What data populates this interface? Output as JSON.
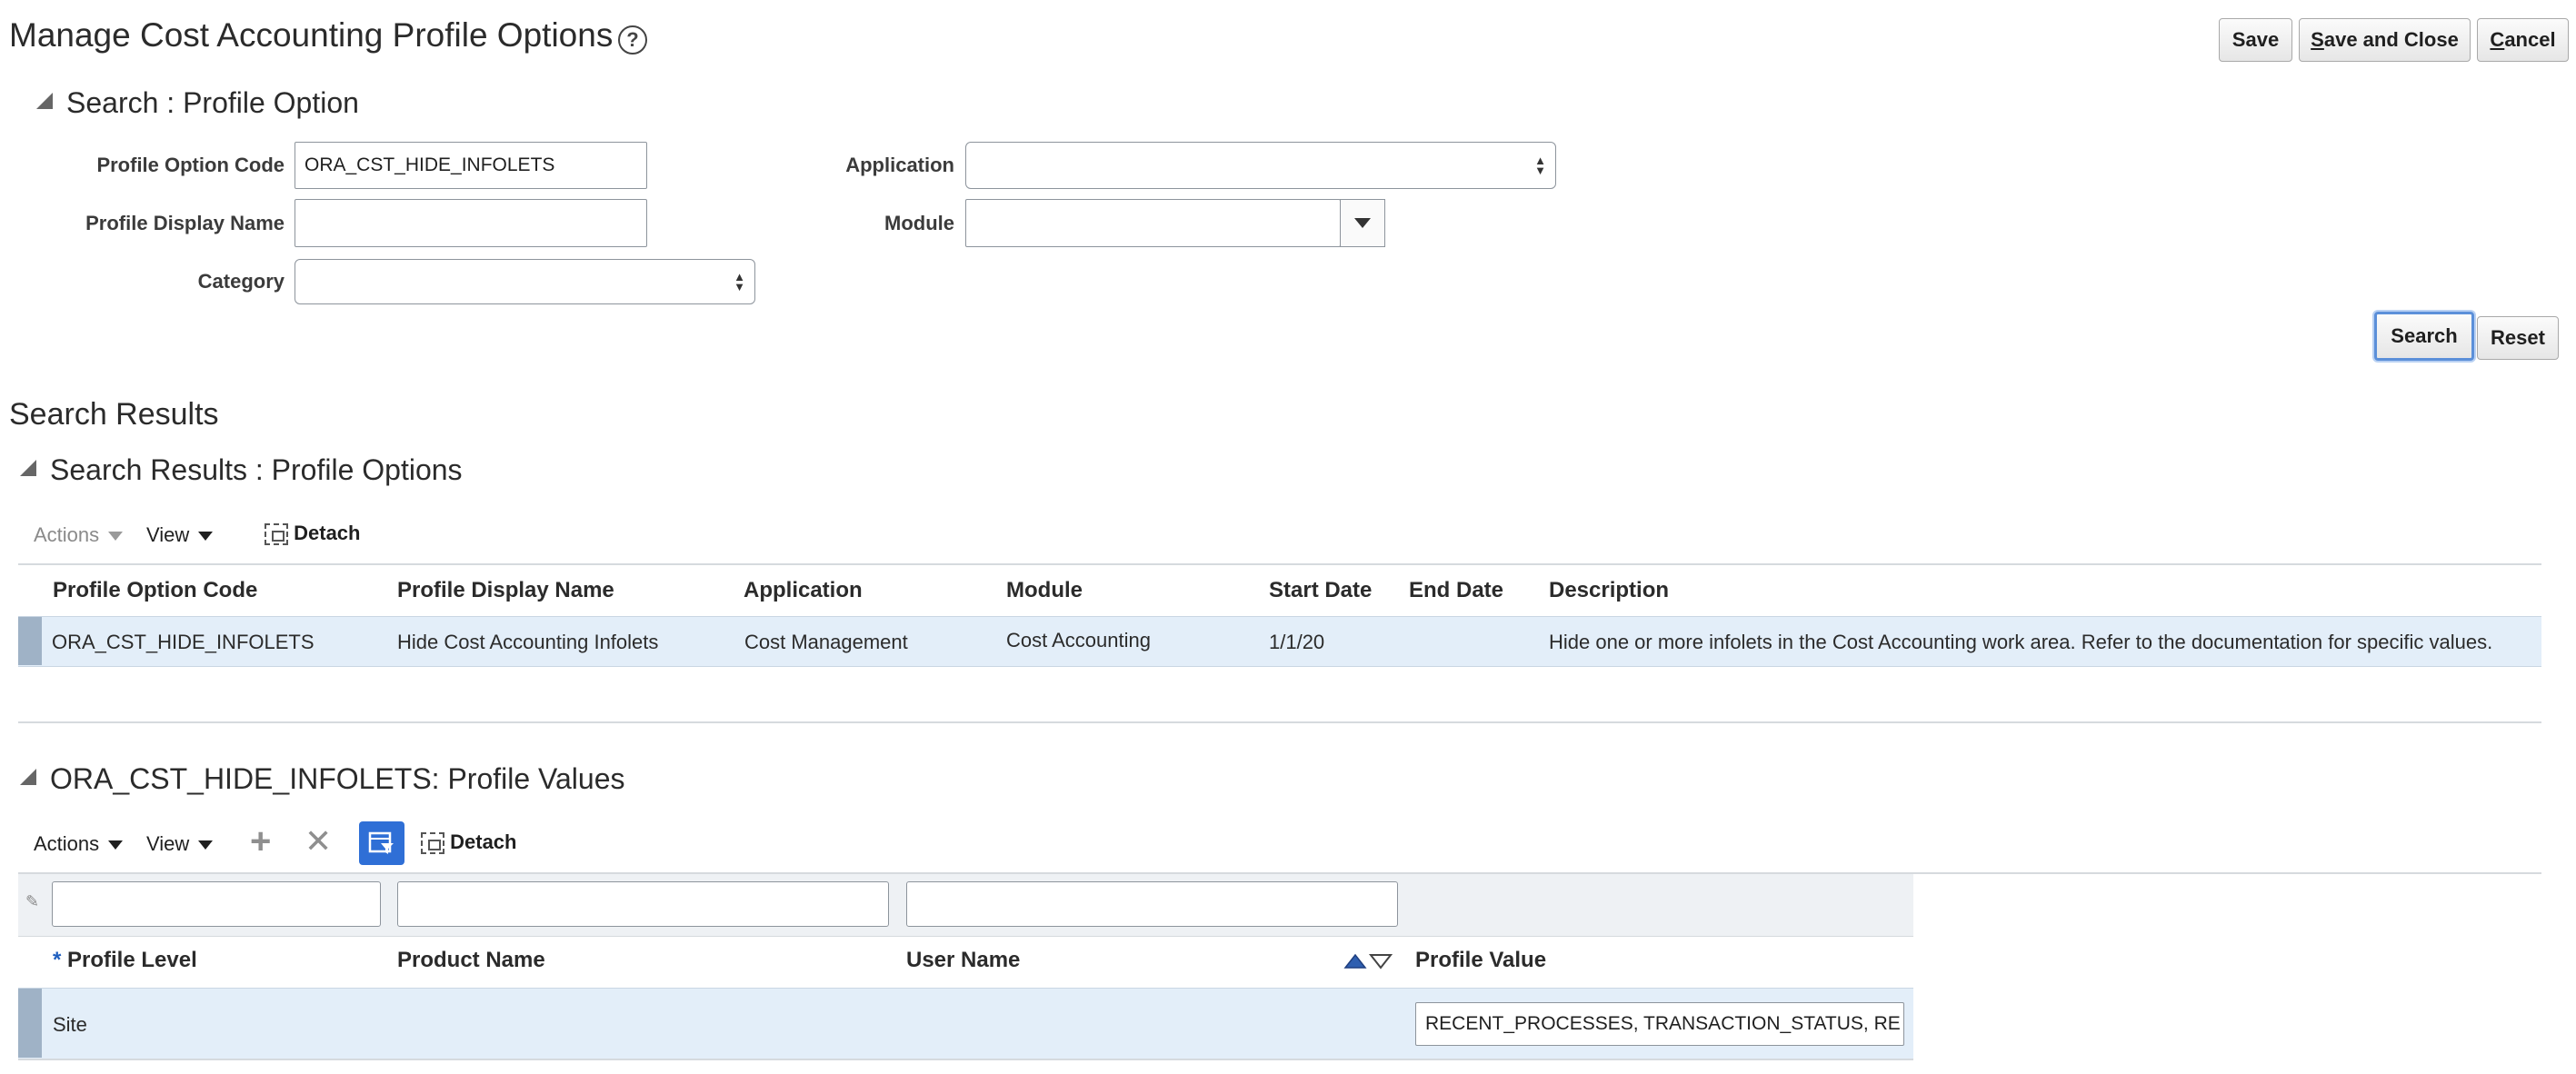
{
  "header": {
    "title": "Manage Cost Accounting Profile Options",
    "help_icon": "question-circle-icon",
    "buttons": {
      "save": "Save",
      "save_and_close_first": "S",
      "save_and_close_rest": "ave and Close",
      "cancel_first": "C",
      "cancel_rest": "ancel"
    }
  },
  "search": {
    "section_title": "Search : Profile Option",
    "fields": {
      "profile_option_code": {
        "label": "Profile Option Code",
        "value": "ORA_CST_HIDE_INFOLETS"
      },
      "profile_display_name": {
        "label": "Profile Display Name",
        "value": ""
      },
      "category": {
        "label": "Category",
        "value": ""
      },
      "application": {
        "label": "Application",
        "value": ""
      },
      "module": {
        "label": "Module",
        "value": ""
      }
    },
    "search_button": "Search",
    "reset_button": "Reset"
  },
  "results": {
    "heading": "Search Results",
    "section_title": "Search Results : Profile Options",
    "toolbar": {
      "actions": "Actions",
      "view": "View",
      "detach": "Detach"
    },
    "columns": [
      "Profile Option Code",
      "Profile Display Name",
      "Application",
      "Module",
      "Start Date",
      "End Date",
      "Description"
    ],
    "rows": [
      [
        "ORA_CST_HIDE_INFOLETS",
        "Hide Cost Accounting Infolets",
        "Cost Management",
        "Cost Accounting",
        "1/1/20",
        "",
        "Hide one or more infolets in the Cost Accounting work area. Refer to the documentation for specific values."
      ]
    ]
  },
  "values": {
    "section_title": "ORA_CST_HIDE_INFOLETS: Profile Values",
    "toolbar": {
      "actions": "Actions",
      "view": "View",
      "detach": "Detach",
      "add_icon": "plus-icon",
      "delete_icon": "x-icon",
      "filter_icon": "query-by-example-icon"
    },
    "filters": [
      "",
      "",
      ""
    ],
    "required_marker": "*",
    "columns": [
      "Profile Level",
      "Product Name",
      "User Name",
      "Profile Value"
    ],
    "rows": [
      {
        "profile_level": "Site",
        "product_name": "",
        "user_name": "",
        "profile_value": "RECENT_PROCESSES, TRANSACTION_STATUS, RE"
      }
    ]
  },
  "colors": {
    "selected_row": "#e3eef9",
    "accent": "#2f6fd6"
  }
}
